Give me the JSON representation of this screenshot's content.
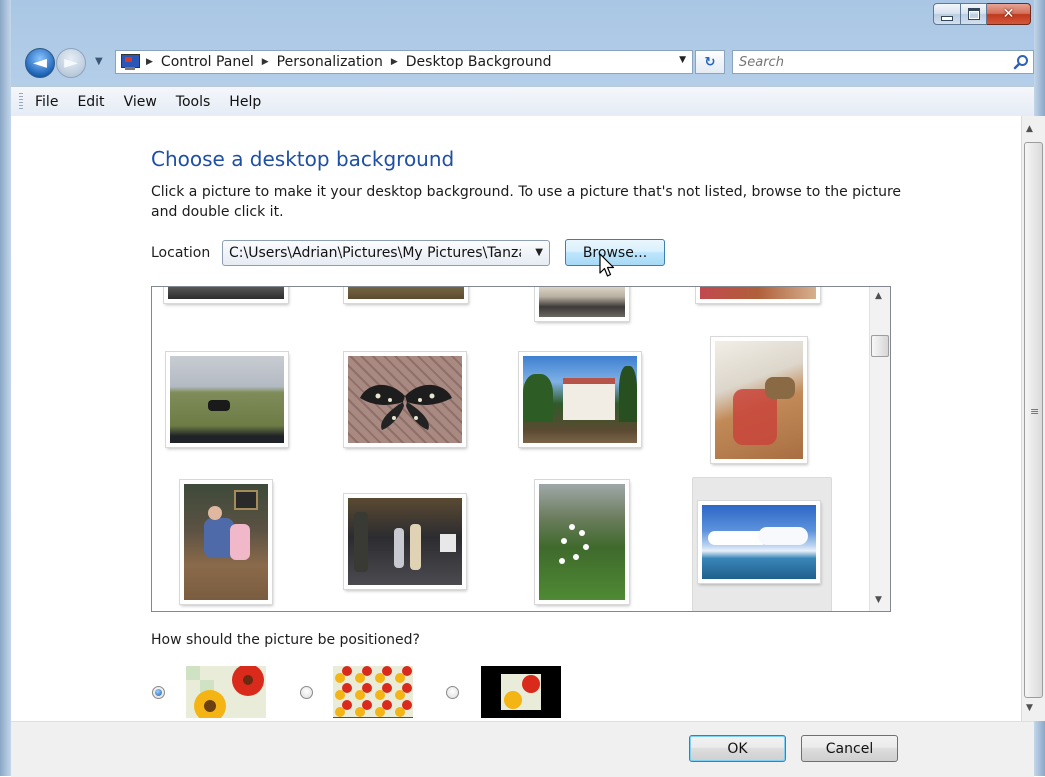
{
  "window": {
    "caption_buttons": [
      "minimize",
      "maximize",
      "close"
    ]
  },
  "nav": {
    "breadcrumb": [
      "Control Panel",
      "Personalization",
      "Desktop Background"
    ],
    "search_placeholder": "Search",
    "icons": [
      "back-arrow-icon",
      "forward-arrow-icon",
      "control-panel-icon",
      "refresh-icon",
      "search-icon"
    ]
  },
  "menu": {
    "items": [
      "File",
      "Edit",
      "View",
      "Tools",
      "Help"
    ]
  },
  "content": {
    "title": "Choose a desktop background",
    "description": "Click a picture to make it your desktop background. To use a picture that's not listed, browse to the picture and double click it.",
    "location_label": "Location",
    "location_value": "C:\\Users\\Adrian\\Pictures\\My Pictures\\Tanzania",
    "browse_label": "Browse...",
    "pictures": [
      "cropped-photo-1",
      "cropped-photo-2",
      "car-photo",
      "cropped-photo-4",
      "cow-field",
      "butterfly",
      "white-house",
      "basket-floor",
      "family-sofa",
      "children-party",
      "tree-flowers",
      "sea-clouds"
    ],
    "selected_picture": "sea-clouds",
    "position_label": "How should the picture be positioned?",
    "position_options": [
      "fit-to-screen",
      "tile",
      "center"
    ],
    "selected_position": "fit-to-screen"
  },
  "buttons": {
    "ok": "OK",
    "cancel": "Cancel"
  },
  "colors": {
    "title_blue": "#1e4fa6",
    "glass_frame": "#b7cfe6",
    "close_red": "#c0391d"
  }
}
